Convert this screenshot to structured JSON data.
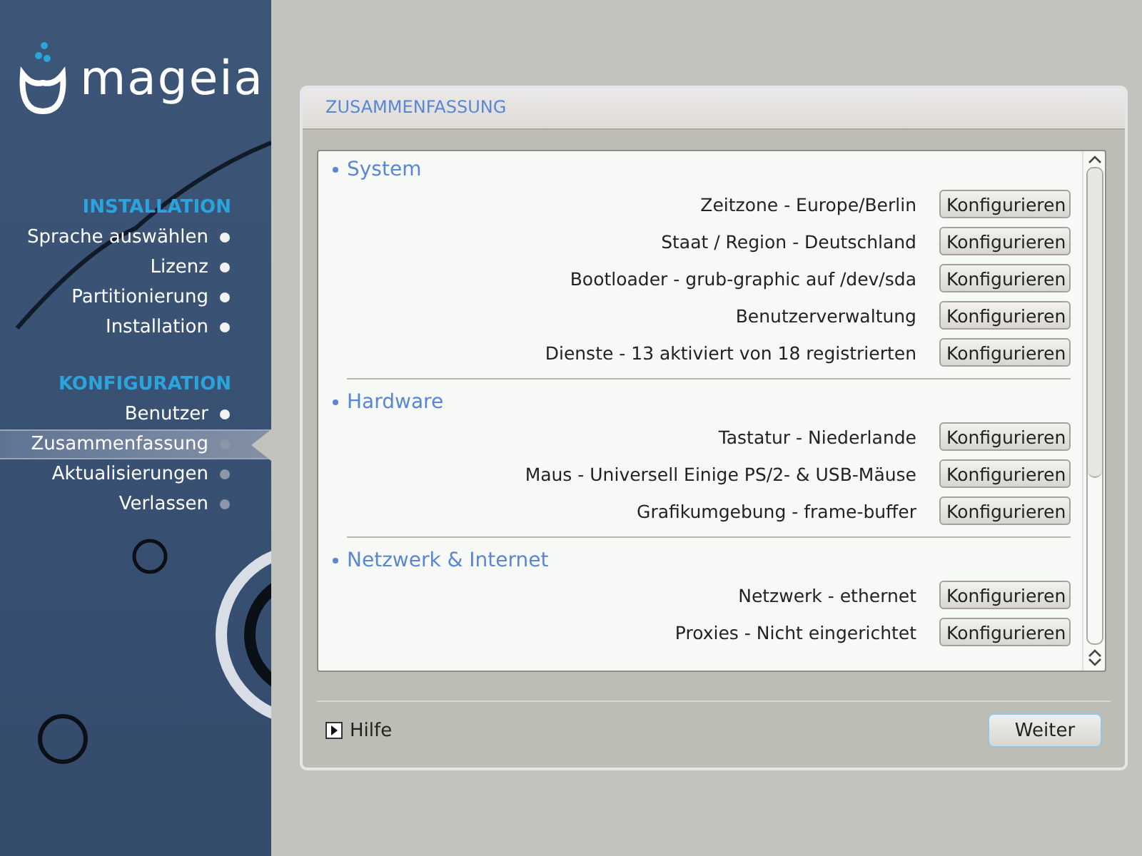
{
  "logo": {
    "text": "mageia"
  },
  "sidebar": {
    "groups": [
      {
        "heading": "INSTALLATION",
        "items": [
          {
            "label": "Sprache auswählen",
            "done": true,
            "selected": false
          },
          {
            "label": "Lizenz",
            "done": true,
            "selected": false
          },
          {
            "label": "Partitionierung",
            "done": true,
            "selected": false
          },
          {
            "label": "Installation",
            "done": true,
            "selected": false
          }
        ]
      },
      {
        "heading": "KONFIGURATION",
        "items": [
          {
            "label": "Benutzer",
            "done": true,
            "selected": false
          },
          {
            "label": "Zusammenfassung",
            "done": false,
            "selected": true
          },
          {
            "label": "Aktualisierungen",
            "done": false,
            "selected": false
          },
          {
            "label": "Verlassen",
            "done": false,
            "selected": false
          }
        ]
      }
    ]
  },
  "panel": {
    "title": "ZUSAMMENFASSUNG",
    "sections": [
      {
        "heading": "System",
        "rows": [
          {
            "text": "Zeitzone - Europe/Berlin",
            "button": "Konfigurieren"
          },
          {
            "text": "Staat / Region - Deutschland",
            "button": "Konfigurieren"
          },
          {
            "text": "Bootloader - grub-graphic auf /dev/sda",
            "button": "Konfigurieren"
          },
          {
            "text": "Benutzerverwaltung",
            "button": "Konfigurieren"
          },
          {
            "text": "Dienste - 13 aktiviert von 18 registrierten",
            "button": "Konfigurieren"
          }
        ]
      },
      {
        "heading": "Hardware",
        "rows": [
          {
            "text": "Tastatur - Niederlande",
            "button": "Konfigurieren"
          },
          {
            "text": "Maus - Universell Einige PS/2- & USB-Mäuse",
            "button": "Konfigurieren"
          },
          {
            "text": "Grafikumgebung - frame-buffer",
            "button": "Konfigurieren"
          }
        ]
      },
      {
        "heading": "Netzwerk & Internet",
        "rows": [
          {
            "text": "Netzwerk - ethernet",
            "button": "Konfigurieren"
          },
          {
            "text": "Proxies - Nicht eingerichtet",
            "button": "Konfigurieren"
          }
        ]
      }
    ],
    "help": "Hilfe",
    "next_button": "Weiter"
  }
}
